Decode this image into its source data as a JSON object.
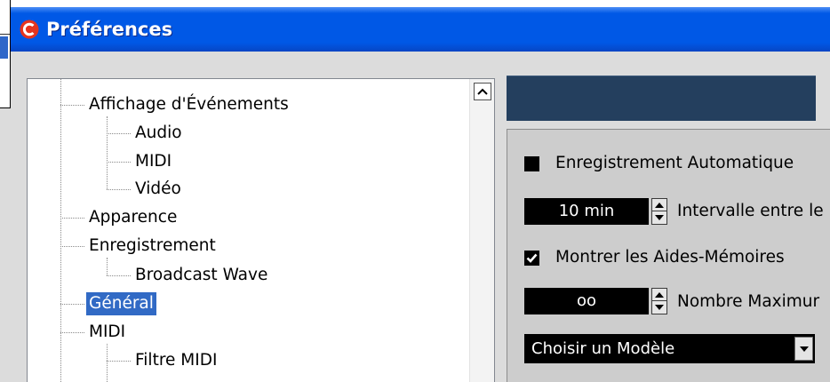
{
  "window": {
    "title": "Préférences",
    "icon": "app-logo-icon"
  },
  "tree": {
    "items": [
      {
        "label": "Affichage d'Événements",
        "children": [
          {
            "label": "Audio"
          },
          {
            "label": "MIDI"
          },
          {
            "label": "Vidéo"
          }
        ]
      },
      {
        "label": "Apparence"
      },
      {
        "label": "Enregistrement",
        "children": [
          {
            "label": "Broadcast Wave"
          }
        ]
      },
      {
        "label": "Général",
        "selected": true
      },
      {
        "label": "MIDI",
        "children": [
          {
            "label": "Filtre MIDI"
          }
        ]
      }
    ],
    "scroll_up_icon": "chevron-up-icon"
  },
  "settings": {
    "auto_save": {
      "label": "Enregistrement Automatique",
      "checked": false
    },
    "save_interval": {
      "value": "10 min",
      "label": "Intervalle entre le"
    },
    "show_notes": {
      "label": "Montrer les Aides-Mémoires",
      "checked": true
    },
    "max_count": {
      "value": "oo",
      "label": "Nombre Maximur"
    },
    "template": {
      "selected": "Choisir un Modèle"
    }
  },
  "icons": {
    "app": "app-logo-icon",
    "scroll_up": "chevron-up-icon",
    "checkbox_checked": "checkmark-icon",
    "spin_up": "triangle-up-icon",
    "spin_down": "triangle-down-icon",
    "dropdown": "triangle-down-icon"
  },
  "colors": {
    "title_bar": "#0058E6",
    "selection": "#316AC5",
    "panel_header": "#243F5E",
    "field": "#000000"
  }
}
